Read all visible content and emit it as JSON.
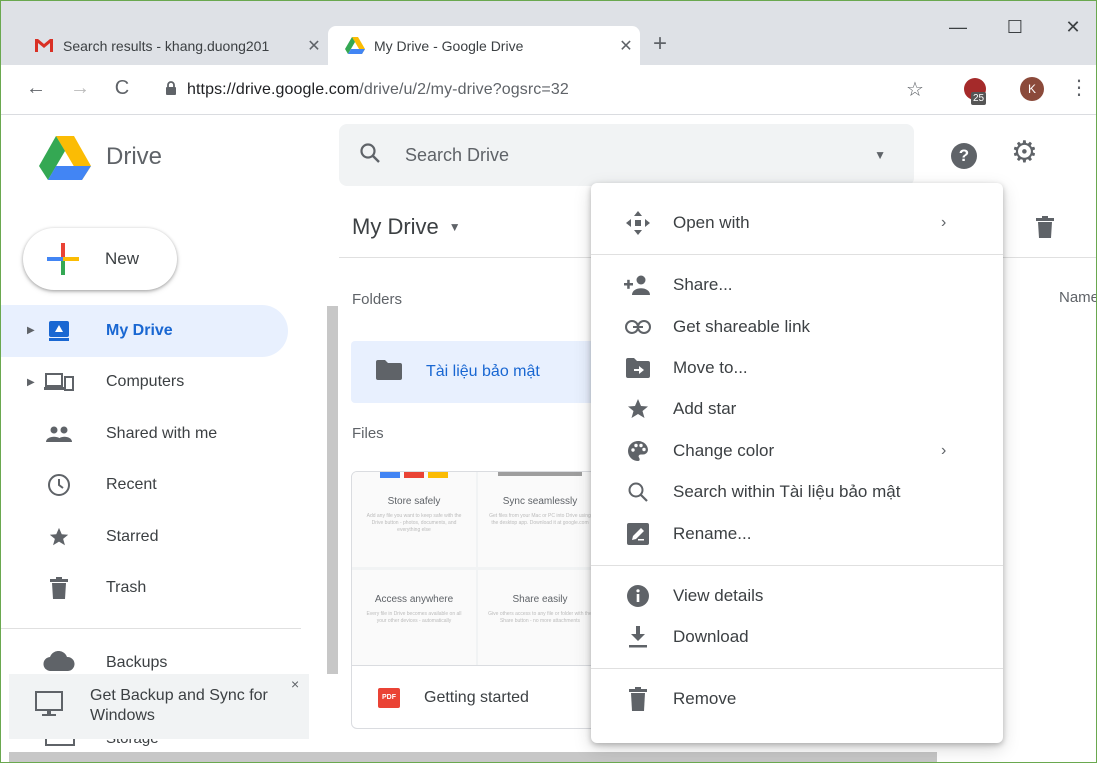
{
  "browser": {
    "tabs": [
      {
        "title": "Search results - khang.duong201",
        "active": false,
        "favicon": "gmail-icon"
      },
      {
        "title": "My Drive - Google Drive",
        "active": true,
        "favicon": "google-drive-icon"
      }
    ],
    "new_tab": "+",
    "window_controls": {
      "minimize": "—",
      "maximize": "☐",
      "close": "✕"
    },
    "url_host": "https://drive.google.com",
    "url_path": "/drive/u/2/my-drive?ogsrc=32",
    "extension_badge": "25",
    "profile_initial": "K"
  },
  "drive": {
    "logo_text": "Drive",
    "search_placeholder": "Search Drive",
    "new_button": "New",
    "nav": [
      {
        "label": "My Drive",
        "icon": "my-drive-icon",
        "active": true,
        "expandable": true
      },
      {
        "label": "Computers",
        "icon": "computers-icon",
        "active": false,
        "expandable": true
      },
      {
        "label": "Shared with me",
        "icon": "people-icon",
        "active": false,
        "expandable": false
      },
      {
        "label": "Recent",
        "icon": "clock-icon",
        "active": false,
        "expandable": false
      },
      {
        "label": "Starred",
        "icon": "star-icon",
        "active": false,
        "expandable": false
      },
      {
        "label": "Trash",
        "icon": "trash-icon",
        "active": false,
        "expandable": false
      }
    ],
    "backups": "Backups",
    "banner_text": "Get Backup and Sync for Windows",
    "banner_close": "×",
    "storage_peek": "Storage",
    "title": "My Drive",
    "name_column": "Name",
    "folders_label": "Folders",
    "folder_name": "Tài liệu bảo mật",
    "files_label": "Files",
    "file_name": "Getting started",
    "file_type": "PDF",
    "thumb_cells": [
      {
        "title": "Store safely",
        "desc": "Add any file you want to keep safe with the Drive button - photos, documents, and everything else"
      },
      {
        "title": "Sync seamlessly",
        "desc": "Get files from your Mac or PC into Drive using the desktop app. Download it at google.com"
      },
      {
        "title": "Access anywhere",
        "desc": "Every file in Drive becomes available on all your other devices - automatically"
      },
      {
        "title": "Share easily",
        "desc": "Give others access to any file or folder with the Share button - no more attachments"
      }
    ]
  },
  "context_menu": {
    "items": [
      {
        "label": "Open with",
        "icon": "move-arrows-icon",
        "submenu": "›"
      },
      {
        "label": "Share...",
        "icon": "add-person-icon",
        "submenu": ""
      },
      {
        "label": "Get shareable link",
        "icon": "link-icon",
        "submenu": ""
      },
      {
        "label": "Move to...",
        "icon": "move-folder-icon",
        "submenu": ""
      },
      {
        "label": "Add star",
        "icon": "star-icon",
        "submenu": ""
      },
      {
        "label": "Change color",
        "icon": "palette-icon",
        "submenu": "›"
      },
      {
        "label": "Search within Tài liệu bảo mật",
        "icon": "search-icon",
        "submenu": ""
      },
      {
        "label": "Rename...",
        "icon": "rename-icon",
        "submenu": ""
      },
      {
        "label": "View details",
        "icon": "info-icon",
        "submenu": ""
      },
      {
        "label": "Download",
        "icon": "download-icon",
        "submenu": ""
      },
      {
        "label": "Remove",
        "icon": "trash-icon",
        "submenu": ""
      }
    ]
  },
  "colors": {
    "accent": "#1967d2",
    "active_bg": "#e8f0fe",
    "text": "#3c4043",
    "icon": "#5f6368"
  }
}
